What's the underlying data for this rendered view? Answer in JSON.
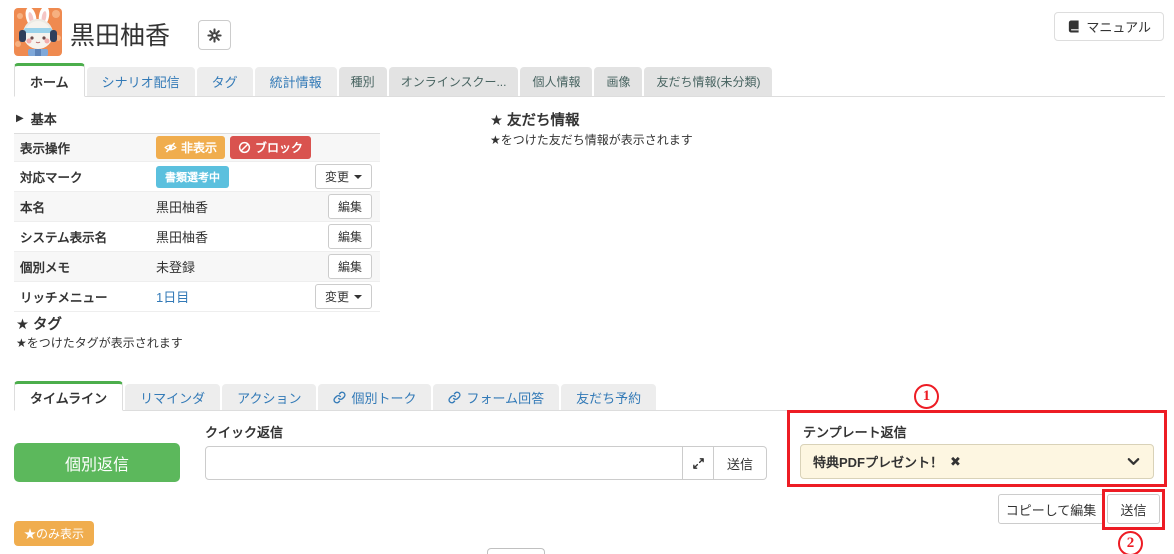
{
  "colors": {
    "accent_green": "#5cb85c",
    "tab_active_border_green": "#4cae4c",
    "link_blue": "#337ab7",
    "badge_orange": "#f0ad4e",
    "badge_red": "#d9534f",
    "badge_cyan": "#5bc0de",
    "annotation_red": "#ed1c24",
    "template_select_bg": "#fdf6e1"
  },
  "header": {
    "title": "黒田柚香",
    "manual_button": "マニュアル"
  },
  "top_tabs": {
    "items": [
      {
        "label": "ホーム"
      },
      {
        "label": "シナリオ配信"
      },
      {
        "label": "タグ"
      },
      {
        "label": "統計情報"
      },
      {
        "label": "種別"
      },
      {
        "label": "オンラインスクー..."
      },
      {
        "label": "個人情報"
      },
      {
        "label": "画像"
      },
      {
        "label": "友だち情報(未分類)"
      }
    ]
  },
  "basic": {
    "section_title": "基本",
    "rows": {
      "display_ops": {
        "label": "表示操作",
        "hide_badge": "非表示",
        "block_badge": "ブロック"
      },
      "mark": {
        "label": "対応マーク",
        "badge": "書類選考中",
        "change_button": "変更"
      },
      "real_name": {
        "label": "本名",
        "value": "黒田柚香",
        "edit_button": "編集"
      },
      "system_name": {
        "label": "システム表示名",
        "value": "黒田柚香",
        "edit_button": "編集"
      },
      "memo": {
        "label": "個別メモ",
        "value": "未登録",
        "edit_button": "編集"
      },
      "rich_menu": {
        "label": "リッチメニュー",
        "value": "1日目",
        "change_button": "変更"
      }
    }
  },
  "tag_section": {
    "title": "★ タグ",
    "note": "★をつけたタグが表示されます"
  },
  "friend_info": {
    "title": "★ 友だち情報",
    "note": "★をつけた友だち情報が表示されます"
  },
  "bottom_tabs": {
    "items": [
      {
        "label": "タイムライン"
      },
      {
        "label": "リマインダ"
      },
      {
        "label": "アクション"
      },
      {
        "label": "個別トーク"
      },
      {
        "label": "フォーム回答"
      },
      {
        "label": "友だち予約"
      }
    ]
  },
  "reply": {
    "individual_reply_button": "個別返信",
    "quick_reply_label": "クイック返信",
    "quick_reply_value": "",
    "send_button": "送信"
  },
  "template_reply": {
    "label": "テンプレート返信",
    "selected_value": "特典PDFプレゼント！",
    "remove_icon": "✖",
    "copy_edit_button": "コピーして編集",
    "send_button": "送信"
  },
  "star_only_button": "★のみ表示",
  "annotations": {
    "step1": "1",
    "step2": "2"
  }
}
